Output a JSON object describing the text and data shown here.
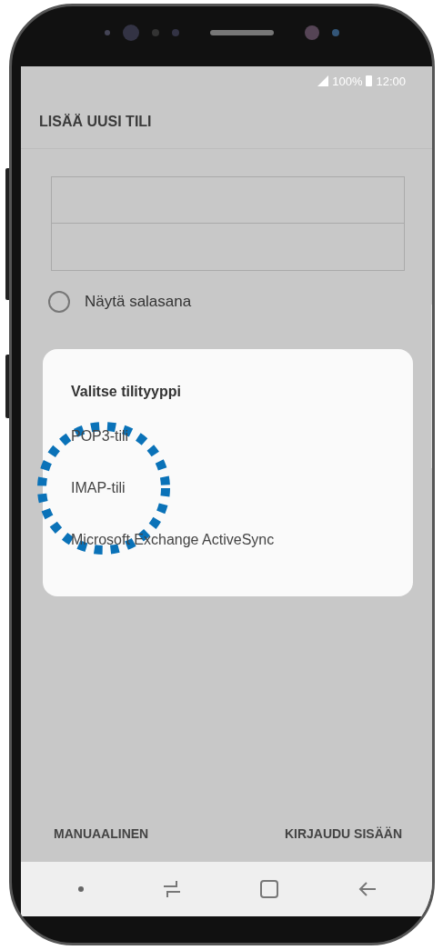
{
  "status_bar": {
    "battery": "100%",
    "time": "12:00"
  },
  "title": "LISÄÄ UUSI TILI",
  "password_toggle": {
    "label": "Näytä salasana",
    "checked": false
  },
  "dialog": {
    "title": "Valitse tilityyppi",
    "options": [
      {
        "label": "POP3-tili",
        "highlighted": false
      },
      {
        "label": "IMAP-tili",
        "highlighted": true
      },
      {
        "label": "Microsoft Exchange ActiveSync",
        "highlighted": false
      }
    ]
  },
  "buttons": [
    "MANUAALINEN",
    "KIRJAUDU SISÄÄN"
  ]
}
